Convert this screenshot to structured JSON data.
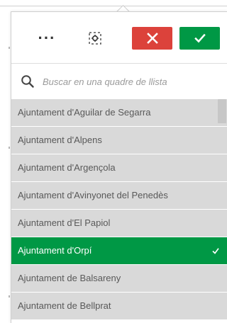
{
  "toolbar": {
    "more_icon": "more-horizontal-icon",
    "select_icon": "selection-tool-icon",
    "cancel_icon": "close-icon",
    "confirm_icon": "check-icon",
    "cancel_color": "#dc423b",
    "confirm_color": "#009845"
  },
  "search": {
    "placeholder": "Buscar en una quadre de llista",
    "icon": "search-icon"
  },
  "list": {
    "items": [
      {
        "label": "Ajuntament d'Aguilar de Segarra",
        "selected": false
      },
      {
        "label": "Ajuntament d'Alpens",
        "selected": false
      },
      {
        "label": "Ajuntament d'Argençola",
        "selected": false
      },
      {
        "label": "Ajuntament d'Avinyonet del Penedès",
        "selected": false
      },
      {
        "label": "Ajuntament d'El Papiol",
        "selected": false
      },
      {
        "label": "Ajuntament d'Orpí",
        "selected": true
      },
      {
        "label": "Ajuntament de Balsareny",
        "selected": false
      },
      {
        "label": "Ajuntament de Bellprat",
        "selected": false
      }
    ],
    "selected_color": "#009845",
    "unselected_color": "#d9d9d9"
  }
}
